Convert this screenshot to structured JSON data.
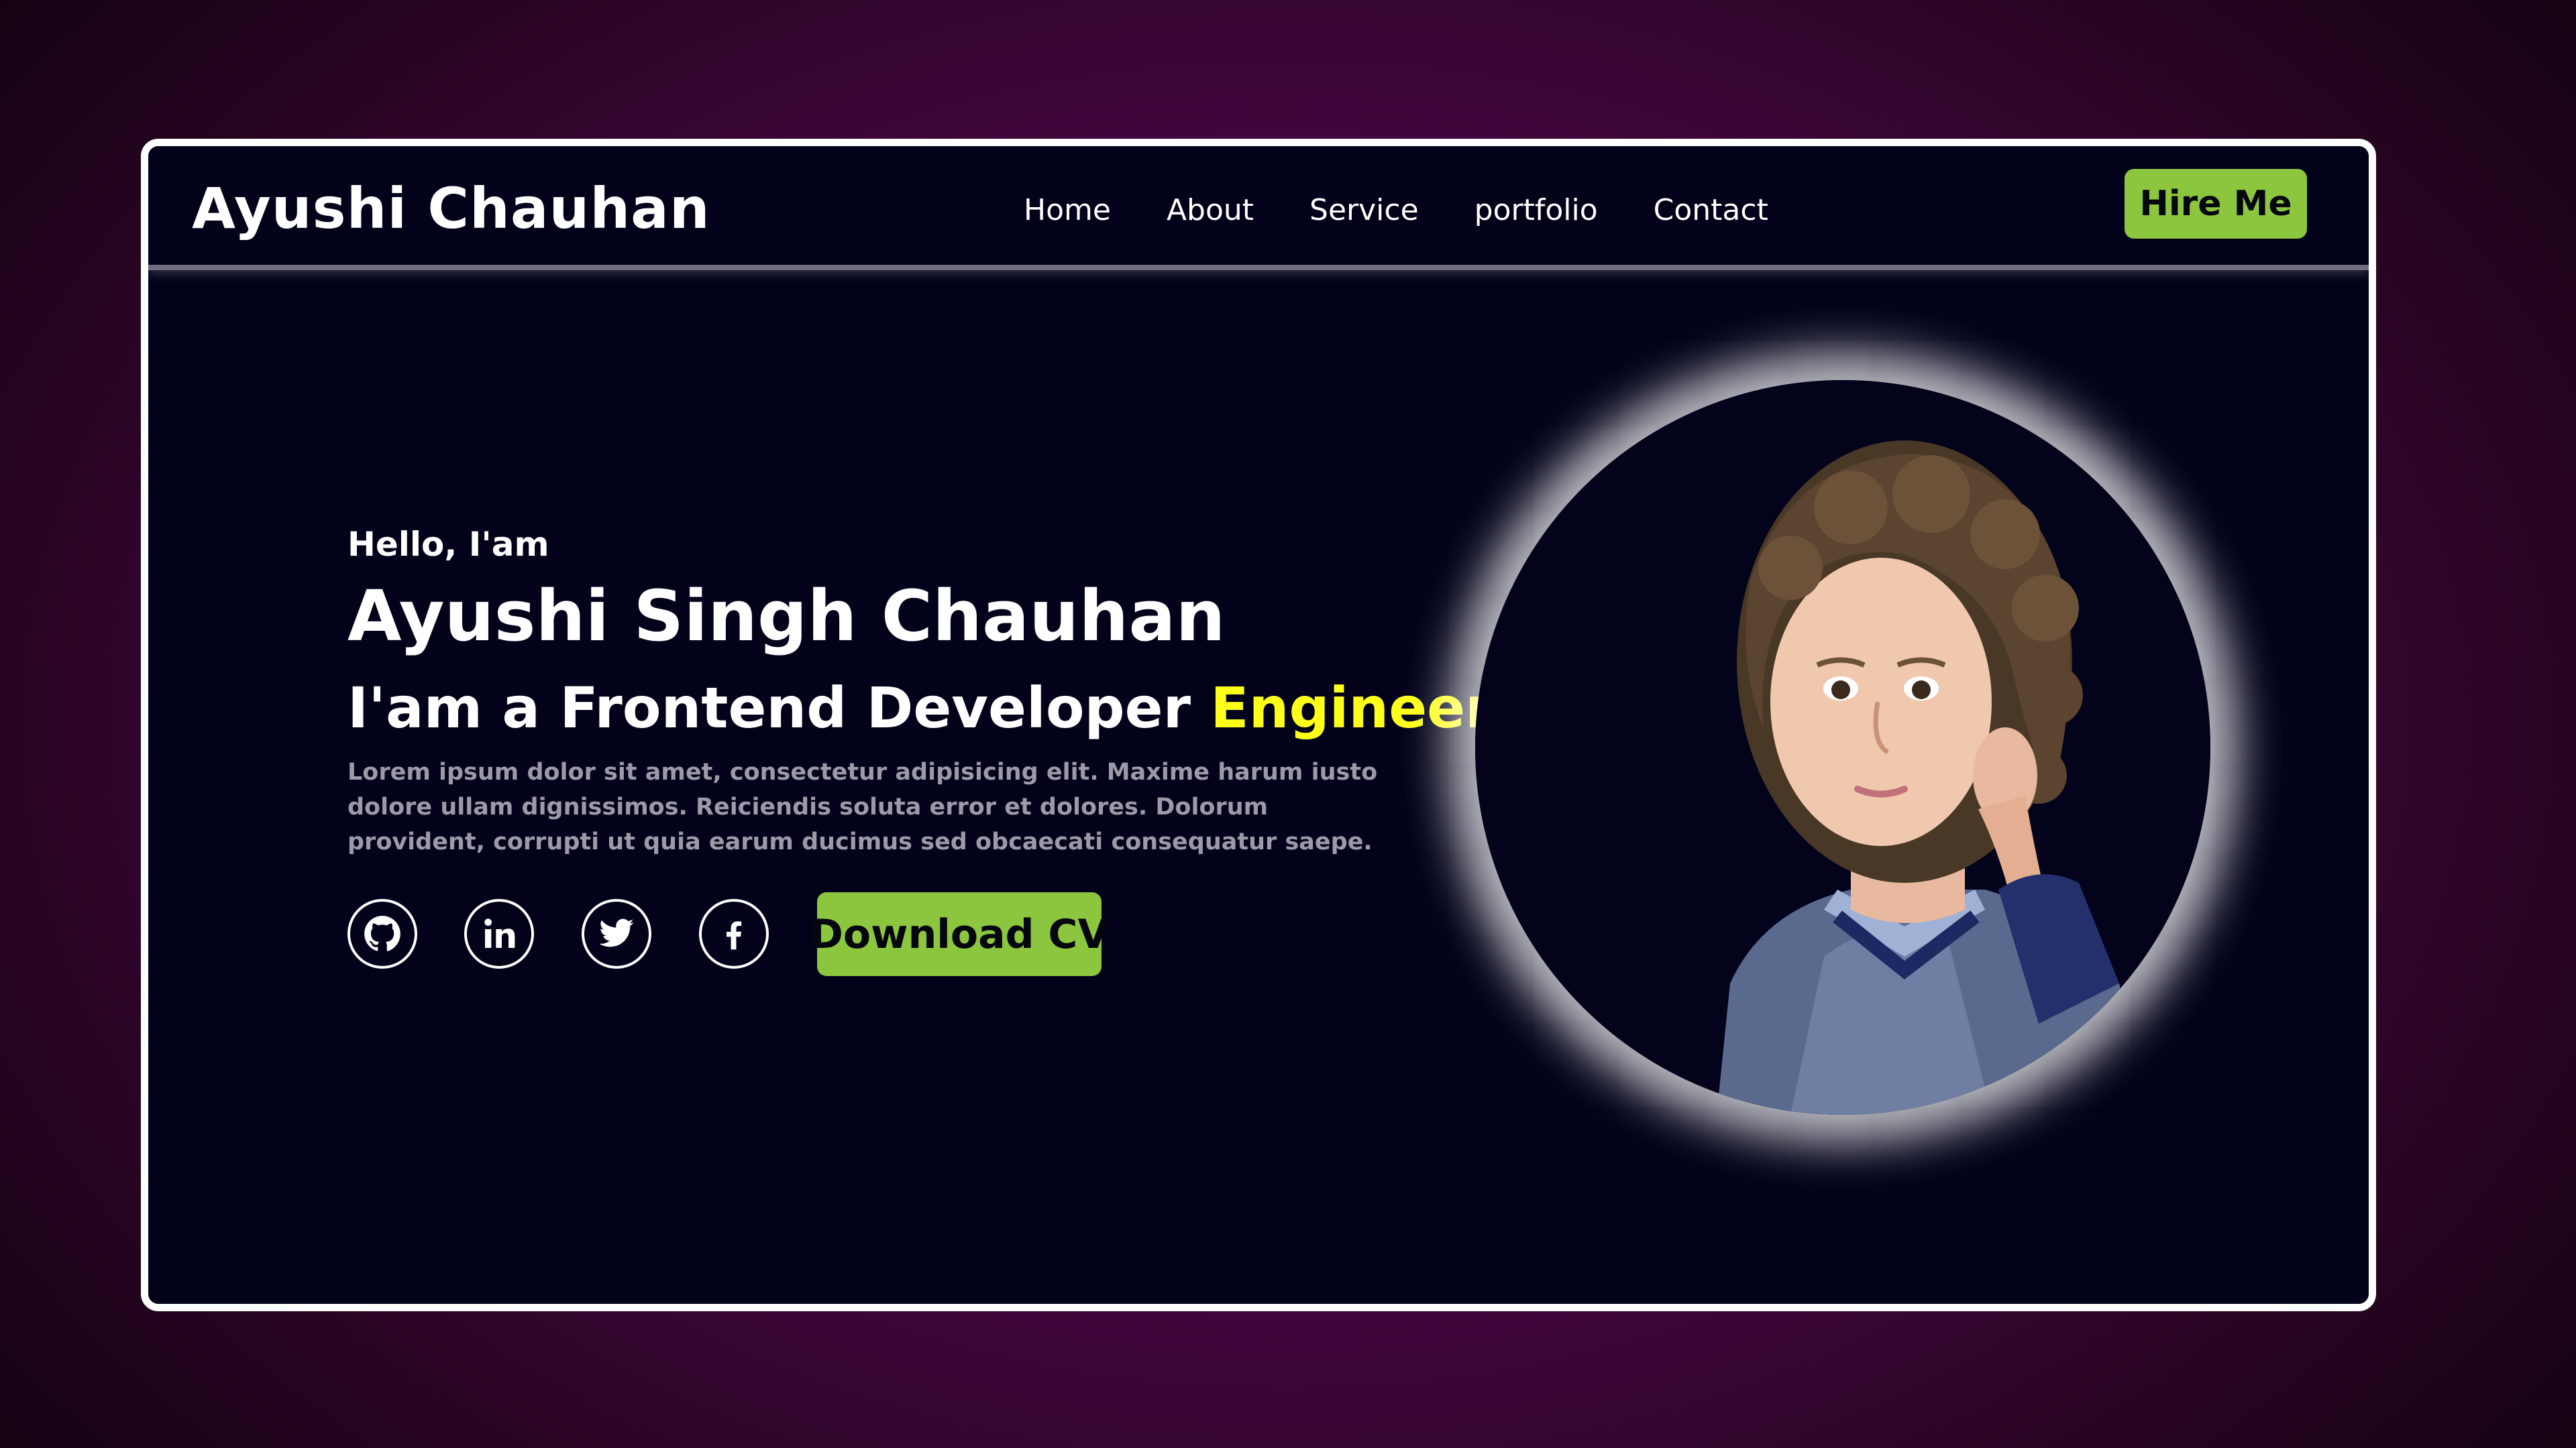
{
  "header": {
    "logo": "Ayushi Chauhan",
    "nav": [
      {
        "label": "Home"
      },
      {
        "label": "About"
      },
      {
        "label": "Service"
      },
      {
        "label": "portfolio"
      },
      {
        "label": "Contact"
      }
    ],
    "hire_label": "Hire Me"
  },
  "hero": {
    "greeting": "Hello, I'am",
    "name": "Ayushi Singh Chauhan",
    "role_prefix": "I'am a Frontend Developer",
    "role_accent": "Engineer",
    "description": "Lorem ipsum dolor sit amet, consectetur adipisicing elit. Maxime harum iusto dolore ullam dignissimos. Reiciendis soluta error et dolores. Dolorum provident, corrupti ut quia earum ducimus sed obcaecati consequatur saepe.",
    "social": [
      {
        "icon": "github-icon"
      },
      {
        "icon": "linkedin-icon"
      },
      {
        "icon": "twitter-icon"
      },
      {
        "icon": "facebook-icon"
      }
    ],
    "download_label": "Download CV"
  },
  "colors": {
    "accent_button": "#8cc63f",
    "accent_text": "#ffff1a",
    "panel_background": "#02021a",
    "page_background": "#44063f"
  }
}
